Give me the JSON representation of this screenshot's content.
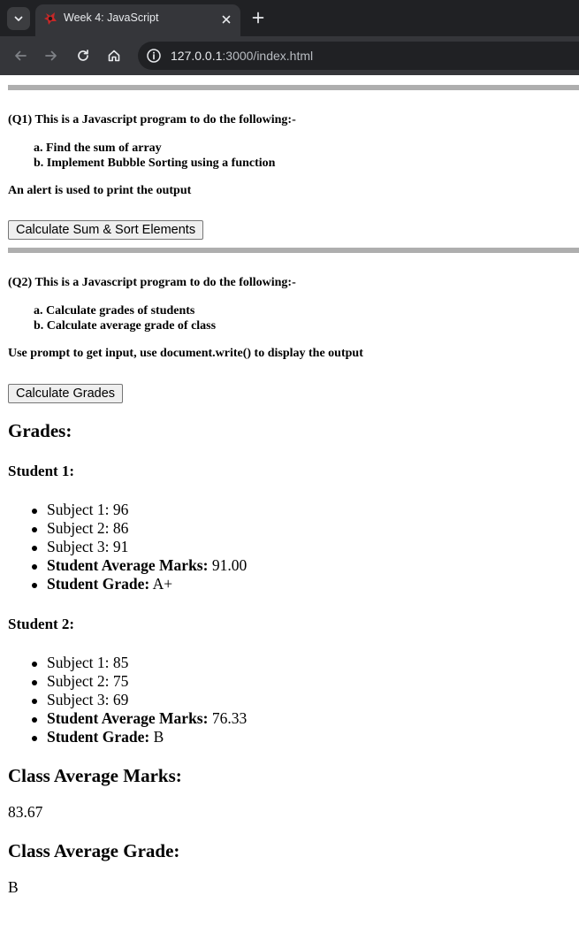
{
  "browser": {
    "tab_title": "Week 4: JavaScript",
    "url_host": "127.0.0.1",
    "url_path": ":3000/index.html"
  },
  "q1": {
    "title": "(Q1) This is a Javascript program to do the following:-",
    "items": [
      "a. Find the sum of array",
      "b. Implement Bubble Sorting using a function"
    ],
    "note": "An alert is used to print the output",
    "button_label": "Calculate Sum & Sort Elements"
  },
  "q2": {
    "title": "(Q2) This is a Javascript program to do the following:-",
    "items": [
      "a. Calculate grades of students",
      "b. Calculate average grade of class"
    ],
    "note": "Use prompt to get input, use document.write() to display the output",
    "button_label": "Calculate Grades"
  },
  "grades": {
    "heading": "Grades:",
    "students": [
      {
        "title": "Student 1:",
        "subjects": [
          "Subject 1: 96",
          "Subject 2: 86",
          "Subject 3: 91"
        ],
        "avg_label": "Student Average Marks:",
        "avg_value": " 91.00",
        "grade_label": "Student Grade:",
        "grade_value": " A+"
      },
      {
        "title": "Student 2:",
        "subjects": [
          "Subject 1: 85",
          "Subject 2: 75",
          "Subject 3: 69"
        ],
        "avg_label": "Student Average Marks:",
        "avg_value": " 76.33",
        "grade_label": "Student Grade:",
        "grade_value": " B"
      }
    ],
    "class_avg_heading": "Class Average Marks:",
    "class_avg_value": "83.67",
    "class_grade_heading": "Class Average Grade:",
    "class_grade_value": "B"
  }
}
